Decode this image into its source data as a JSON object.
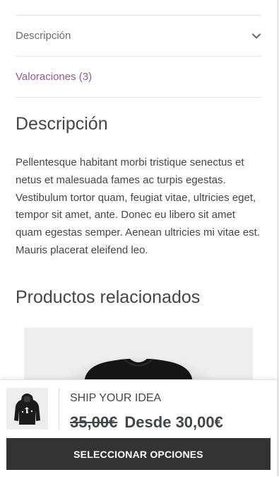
{
  "tabs": [
    {
      "label": "Descripción",
      "active": false
    },
    {
      "label": "Valoraciones (3)",
      "active": false
    }
  ],
  "description": {
    "title": "Descripción",
    "text": "Pellentesque habitant morbi tristique senectus et netus et malesuada fames ac turpis egestas. Vestibulum tortor quam, feugiat vitae, ultricies eget, tempor sit amet, ante. Donec eu libero sit amet quam egestas semper. Aenean ultricies mi vitae est. Mauris placerat eleifend leo."
  },
  "related": {
    "title": "Productos relacionados"
  },
  "sticky_bar": {
    "product_name": "SHIP YOUR IDEA",
    "old_price": "35,00€",
    "new_price": "Desde 30,00€",
    "button_label": "SELECCIONAR OPCIONES"
  },
  "colors": {
    "accent_link": "#96588a",
    "button_bg": "#333333"
  },
  "icons": {
    "tab_toggle": "chevron-down-icon"
  }
}
